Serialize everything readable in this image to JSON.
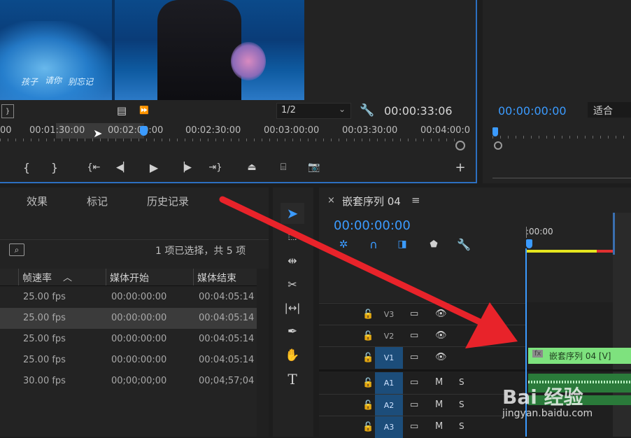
{
  "program_monitor": {
    "subtitles": [
      "孩子",
      "请你",
      "别忘记"
    ],
    "resolution": "1/2",
    "timecode": "00:00:33:06",
    "ruler": [
      "00",
      "00:01:30:00",
      "00:02:00:00",
      "00:02:30:00",
      "00:03:00:00",
      "00:03:30:00",
      "00:04:00:0"
    ]
  },
  "source_monitor": {
    "timecode": "00:00:00:00",
    "zoom": "适合"
  },
  "project_panel": {
    "tabs": [
      "效果",
      "标记",
      "历史记录"
    ],
    "selection_info": "1 项已选择，共 5 项",
    "columns": [
      "帧速率",
      "媒体开始",
      "媒体结束"
    ],
    "rows": [
      {
        "fps": "25.00 fps",
        "start": "00:00:00:00",
        "end": "00:04:05:14"
      },
      {
        "fps": "25.00 fps",
        "start": "00:00:00:00",
        "end": "00:04:05:14"
      },
      {
        "fps": "25.00 fps",
        "start": "00:00:00:00",
        "end": "00:04:05:14"
      },
      {
        "fps": "25.00 fps",
        "start": "00:00:00:00",
        "end": "00:04:05:14"
      },
      {
        "fps": "30.00 fps",
        "start": "00;00;00;00",
        "end": "00;04;57;04"
      }
    ]
  },
  "timeline": {
    "close": "×",
    "title": "嵌套序列 04",
    "timecode": "00:00:00:00",
    "ruler_start": ":00:00",
    "video_tracks": [
      "V3",
      "V2",
      "V1"
    ],
    "audio_tracks": [
      "A1",
      "A2",
      "A3"
    ],
    "mute": "M",
    "solo": "S",
    "clip_label": "嵌套序列 04 [V]",
    "clip_fx": "fx"
  },
  "watermark": {
    "brand": "Bai 经验",
    "url": "jingyan.baidu.com"
  },
  "colors": {
    "accent_blue": "#3b9bff",
    "clip_green": "#7ee27e",
    "arrow_red": "#e8232a"
  }
}
